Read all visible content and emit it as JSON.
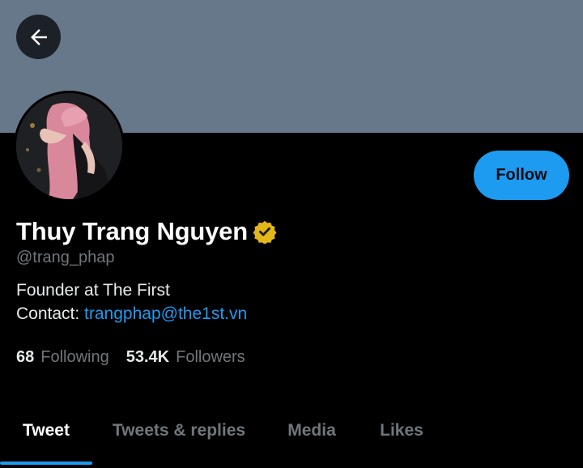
{
  "profile": {
    "name": "Thuy Trang Nguyen",
    "handle": "@trang_phap",
    "verified": true,
    "bio_line1": "Founder at The First",
    "contact_label": "Contact: ",
    "contact_email": "trangphap@the1st.vn"
  },
  "actions": {
    "back_icon": "arrow-left-icon",
    "follow_label": "Follow"
  },
  "stats": {
    "following_count": "68",
    "following_label": "Following",
    "followers_count": "53.4K",
    "followers_label": "Followers"
  },
  "tabs": [
    {
      "label": "Tweet",
      "active": true
    },
    {
      "label": "Tweets & replies",
      "active": false
    },
    {
      "label": "Media",
      "active": false
    },
    {
      "label": "Likes",
      "active": false
    }
  ],
  "colors": {
    "banner": "#66788a",
    "accent": "#1d9bf0",
    "badge": "#e2b719",
    "muted_text": "#71767b"
  }
}
